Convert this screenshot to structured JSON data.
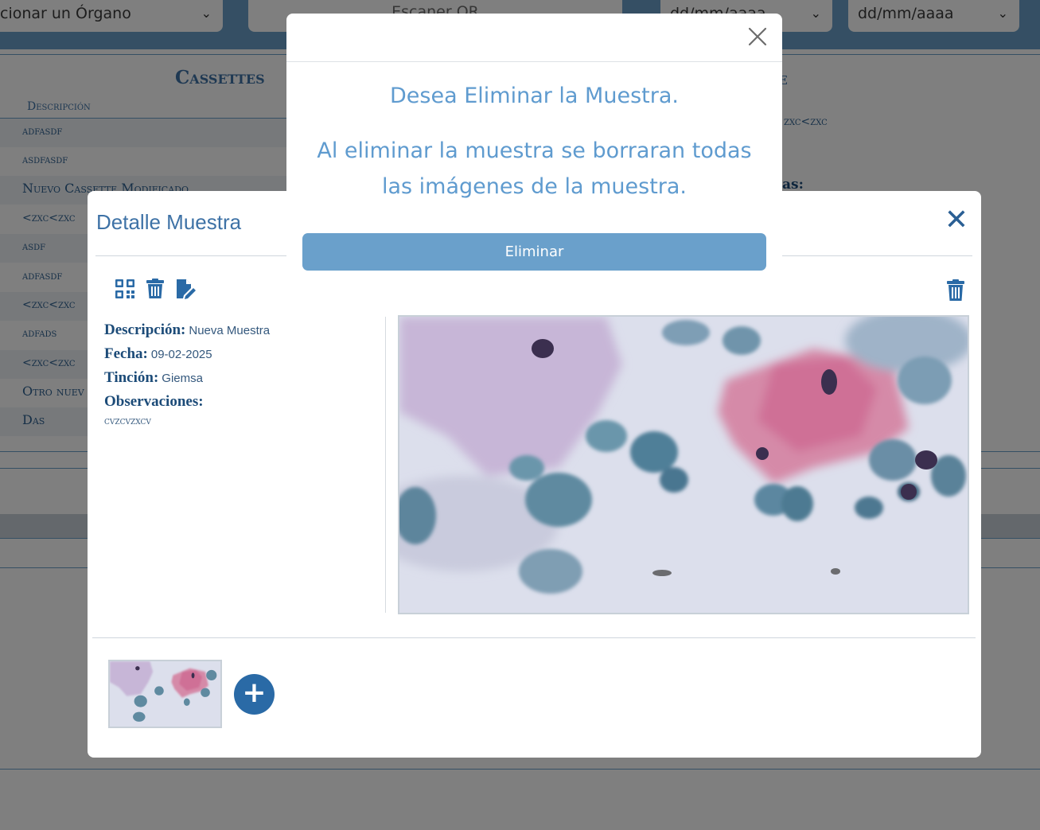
{
  "topbar": {
    "organo": "cionar un Órgano",
    "qr": "Escaner QR",
    "fecha_desde": "dd/mm/aaaa",
    "fecha_hasta": "dd/mm/aaaa"
  },
  "cassettes": {
    "title": "Cassettes",
    "column_header": "Descripción",
    "rows": [
      "adfasdf",
      "asdfasdf",
      "Nuevo Cassette Modificado",
      "<zxc<zxc",
      "asdf",
      "adfasdf",
      "<zxc<zxc",
      "adfads",
      "<zxc<zxc",
      "Otro nuev",
      "Das"
    ]
  },
  "cassette_detail": {
    "title": "ette",
    "text": "zxc<zxc",
    "label": "as:"
  },
  "detail_modal": {
    "title": "Detalle Muestra",
    "close": "✕",
    "descripcion_label": "Descripción:",
    "descripcion_value": "Nueva Muestra",
    "fecha_label": "Fecha:",
    "fecha_value": "09-02-2025",
    "tincion_label": "Tinción:",
    "tincion_value": "Giemsa",
    "observaciones_label": "Observaciones:",
    "observaciones_value": "cvzcvzxcv",
    "add_button": "+"
  },
  "confirm_modal": {
    "title": "Desea Eliminar la Muestra.",
    "message": "Al eliminar la muestra se borraran todas las imágenes de la muestra.",
    "button": "Eliminar"
  },
  "icons": [
    "qr-code-icon",
    "trash-icon",
    "edit-document-icon",
    "trash-icon",
    "close-icon",
    "chevron-down-icon",
    "plus-icon"
  ],
  "colors": {
    "accent": "#6a9ec9",
    "primary_dark": "#2a6aa6",
    "title": "#3e72a6",
    "confirm_text": "#5f9bcf",
    "confirm_button": "#6aa0cb"
  }
}
